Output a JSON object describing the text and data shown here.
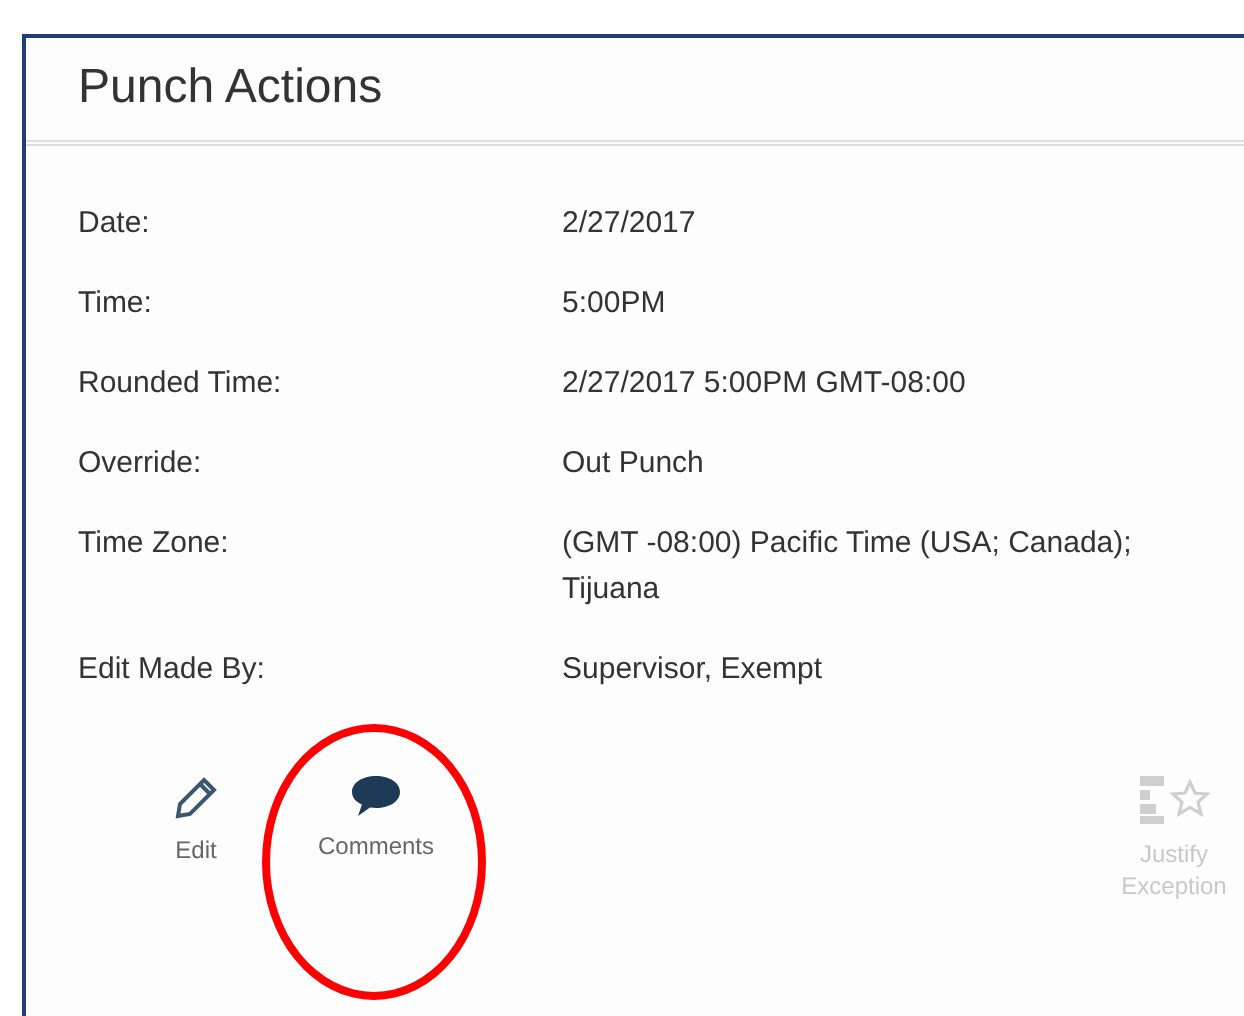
{
  "panel": {
    "title": "Punch Actions"
  },
  "details": [
    {
      "label": "Date:",
      "value": "2/27/2017"
    },
    {
      "label": "Time:",
      "value": "5:00PM"
    },
    {
      "label": "Rounded Time:",
      "value": "2/27/2017 5:00PM GMT-08:00"
    },
    {
      "label": "Override:",
      "value": "Out Punch"
    },
    {
      "label": "Time Zone:",
      "value": "(GMT -08:00) Pacific Time (USA; Canada); Tijuana"
    },
    {
      "label": "Edit Made By:",
      "value": "Supervisor, Exempt"
    }
  ],
  "actions": [
    {
      "kind": "edit",
      "label": "Edit",
      "disabled": false
    },
    {
      "kind": "comments",
      "label": "Comments",
      "disabled": false
    },
    {
      "kind": "justify",
      "label": "Justify Exception",
      "disabled": true
    }
  ],
  "annotation": {
    "kind": "ellipse",
    "color": "#ff0000"
  }
}
